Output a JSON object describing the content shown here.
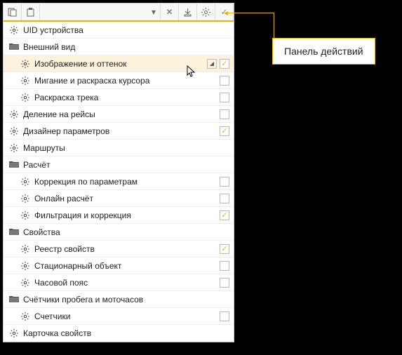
{
  "callout": {
    "label": "Панель действий"
  },
  "toolbar": {
    "copy": "copy",
    "paste": "paste",
    "dropdown": "▾",
    "close": "✕",
    "export": "export",
    "settings": "gear",
    "apply": "✓"
  },
  "rows": [
    {
      "icon": "gear",
      "label": "UID устройства",
      "indent": false,
      "cb": null,
      "sel": false
    },
    {
      "icon": "folder",
      "label": "Внешний вид",
      "indent": false,
      "cb": null,
      "sel": false
    },
    {
      "icon": "gear",
      "label": "Изображение и оттенок",
      "indent": true,
      "cb": "✓",
      "sel": true
    },
    {
      "icon": "gear",
      "label": "Мигание и раскраска курсора",
      "indent": true,
      "cb": "",
      "sel": false
    },
    {
      "icon": "gear",
      "label": "Раскраска трека",
      "indent": true,
      "cb": "",
      "sel": false
    },
    {
      "icon": "gear",
      "label": "Деление на рейсы",
      "indent": false,
      "cb": "",
      "sel": false
    },
    {
      "icon": "gear",
      "label": "Дизайнер параметров",
      "indent": false,
      "cb": "✓",
      "sel": false
    },
    {
      "icon": "gear",
      "label": "Маршруты",
      "indent": false,
      "cb": null,
      "sel": false
    },
    {
      "icon": "folder",
      "label": "Расчёт",
      "indent": false,
      "cb": null,
      "sel": false
    },
    {
      "icon": "gear",
      "label": "Коррекция по параметрам",
      "indent": true,
      "cb": "",
      "sel": false
    },
    {
      "icon": "gear",
      "label": "Онлайн расчёт",
      "indent": true,
      "cb": "",
      "sel": false
    },
    {
      "icon": "gear",
      "label": "Фильтрация и коррекция",
      "indent": true,
      "cb": "✓",
      "sel": false
    },
    {
      "icon": "folder",
      "label": "Свойства",
      "indent": false,
      "cb": null,
      "sel": false
    },
    {
      "icon": "gear",
      "label": "Реестр свойств",
      "indent": true,
      "cb": "✓",
      "sel": false
    },
    {
      "icon": "gear",
      "label": "Стационарный объект",
      "indent": true,
      "cb": "",
      "sel": false
    },
    {
      "icon": "gear",
      "label": "Часовой пояс",
      "indent": true,
      "cb": "",
      "sel": false
    },
    {
      "icon": "folder",
      "label": "Счётчики пробега и моточасов",
      "indent": false,
      "cb": null,
      "sel": false
    },
    {
      "icon": "gear",
      "label": "Счетчики",
      "indent": true,
      "cb": "",
      "sel": false
    },
    {
      "icon": "gear",
      "label": "Карточка свойств",
      "indent": false,
      "cb": null,
      "sel": false
    }
  ]
}
